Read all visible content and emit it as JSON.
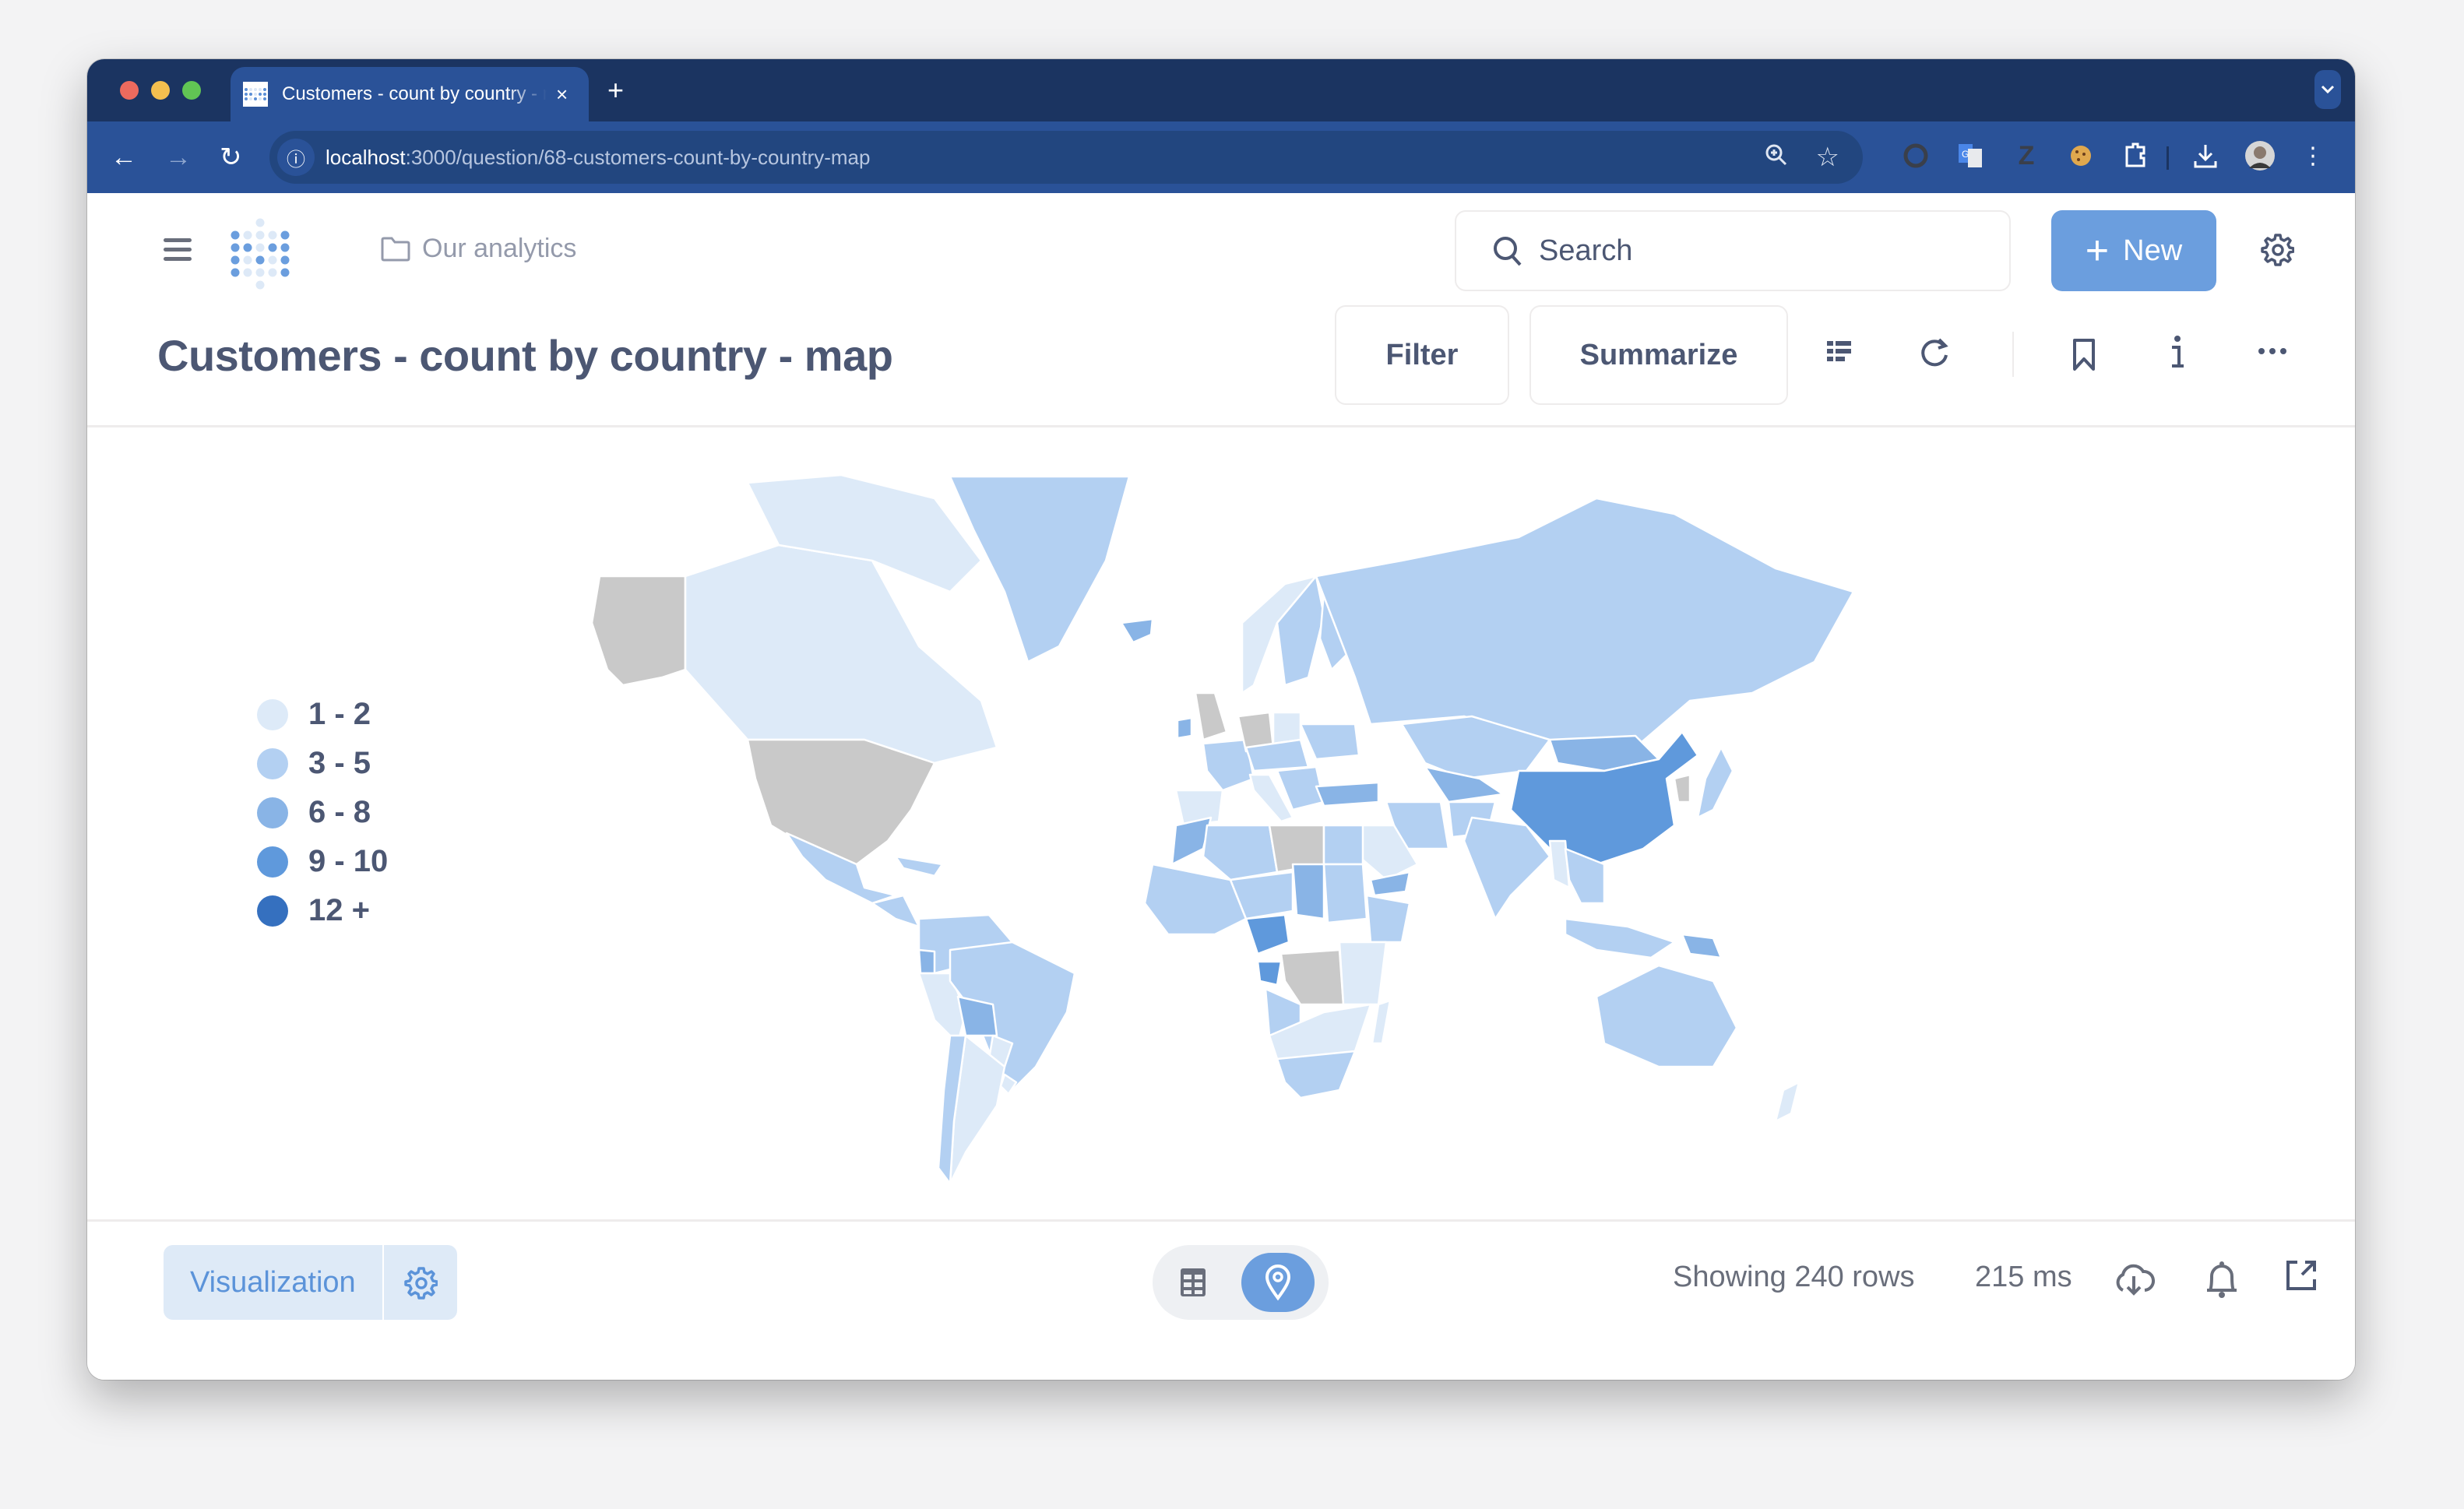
{
  "browser": {
    "tab_title": "Customers - count by country - map",
    "tab_close": "×",
    "new_tab": "+",
    "tab_menu": "⌄",
    "url_host": "localhost",
    "url_rest": ":3000/question/68-customers-count-by-country-map",
    "nav": {
      "back": "←",
      "forward": "→",
      "reload": "↻"
    }
  },
  "app": {
    "breadcrumb": "Our analytics",
    "search_label": "Search",
    "new_label": "New",
    "new_icon": "+",
    "question_title": "Customers - count by country - map",
    "filter_label": "Filter",
    "summarize_label": "Summarize"
  },
  "legend": {
    "items": [
      {
        "label": "1 - 2",
        "color": "#ddeaf8"
      },
      {
        "label": "3 - 5",
        "color": "#b3d0f2"
      },
      {
        "label": "6 - 8",
        "color": "#89b4e6"
      },
      {
        "label": "9 - 10",
        "color": "#5f99dc"
      },
      {
        "label": "12 +",
        "color": "#3570bf"
      }
    ]
  },
  "colors": {
    "accent": "#6b9ede",
    "no_data": "#c9c9c9",
    "text": "#4c5773"
  },
  "map": {
    "buckets_by_region": {
      "alaska": "none",
      "canada": "1-2",
      "arctic-islands": "1-2",
      "greenland": "3-5",
      "iceland": "6-8",
      "usa": "none",
      "mexico": "3-5",
      "central-america": "3-5",
      "caribbean": "3-5",
      "colombia-venezuela": "3-5",
      "ecuador": "6-8",
      "peru": "1-2",
      "brazil": "3-5",
      "bolivia": "6-8",
      "paraguay": "1-2",
      "argentina": "1-2",
      "chile": "3-5",
      "uruguay": "1-2",
      "uk": "none",
      "ireland": "6-8",
      "norway": "1-2",
      "sweden": "3-5",
      "finland": "3-5",
      "france": "3-5",
      "spain": "1-2",
      "germany": "none",
      "poland": "1-2",
      "central-europe": "3-5",
      "italy": "1-2",
      "balkans": "3-5",
      "ukraine": "3-5",
      "turkey": "6-8",
      "russia": "3-5",
      "kazakhstan": "3-5",
      "central-asia": "6-8",
      "mongolia": "6-8",
      "china": "9-10",
      "korea": "none",
      "japan": "3-5",
      "iran": "3-5",
      "afghanistan": "3-5",
      "saudi-arabia": "1-2",
      "yemen": "6-8",
      "india": "3-5",
      "myanmar": "1-2",
      "southeast-asia": "3-5",
      "indonesia": "3-5",
      "papua-new-guinea": "6-8",
      "australia": "3-5",
      "new-zealand": "1-2",
      "morocco": "6-8",
      "algeria": "3-5",
      "libya": "none",
      "egypt": "3-5",
      "west-africa": "3-5",
      "mali-niger": "3-5",
      "nigeria": "9-10",
      "chad": "6-8",
      "sudan": "3-5",
      "ethiopia": "3-5",
      "drc": "none",
      "angola": "3-5",
      "east-africa": "1-2",
      "southern-africa": "1-2",
      "south-africa": "3-5",
      "madagascar": "1-2",
      "gabon": "9-10"
    }
  },
  "footer": {
    "viz_label": "Visualization",
    "rows_text": "Showing 240 rows",
    "time_text": "215 ms"
  }
}
